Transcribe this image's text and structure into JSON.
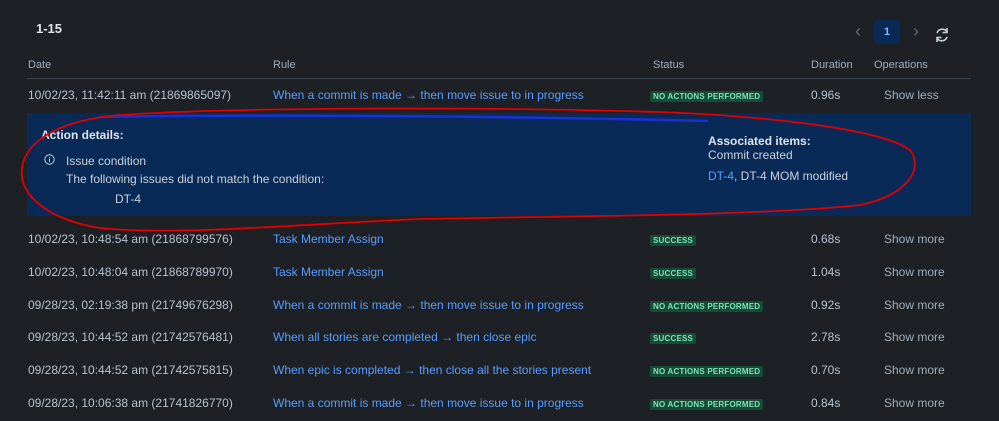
{
  "range": "1-15",
  "pager": {
    "prev": "‹",
    "page": "1",
    "next": "›"
  },
  "headers": {
    "date": "Date",
    "rule": "Rule",
    "status": "Status",
    "duration": "Duration",
    "operations": "Operations"
  },
  "rows": [
    {
      "date": "10/02/23, 11:42:11 am (21869865097)",
      "rule": "When a commit is made → then move issue to in progress",
      "status": "NO ACTIONS PERFORMED",
      "duration": "0.96s",
      "op": "Show less"
    },
    {
      "date": "10/02/23, 10:48:54 am (21868799576)",
      "rule": "Task Member Assign",
      "status": "SUCCESS",
      "duration": "0.68s",
      "op": "Show more"
    },
    {
      "date": "10/02/23, 10:48:04 am (21868789970)",
      "rule": "Task Member Assign",
      "status": "SUCCESS",
      "duration": "1.04s",
      "op": "Show more"
    },
    {
      "date": "09/28/23, 02:19:38 pm (21749676298)",
      "rule": "When a commit is made → then move issue to in progress",
      "status": "NO ACTIONS PERFORMED",
      "duration": "0.92s",
      "op": "Show more"
    },
    {
      "date": "09/28/23, 10:44:52 am (21742576481)",
      "rule": "When all stories are completed → then close epic",
      "status": "SUCCESS",
      "duration": "2.78s",
      "op": "Show more"
    },
    {
      "date": "09/28/23, 10:44:52 am (21742575815)",
      "rule": "When epic is completed → then close all the stories present",
      "status": "NO ACTIONS PERFORMED",
      "duration": "0.70s",
      "op": "Show more"
    },
    {
      "date": "09/28/23, 10:06:38 am (21741826770)",
      "rule": "When a commit is made → then move issue to in progress",
      "status": "NO ACTIONS PERFORMED",
      "duration": "0.84s",
      "op": "Show more"
    }
  ],
  "details": {
    "title": "Action details:",
    "condition": "Issue condition",
    "message": "The following issues did not match the condition:",
    "issue_key": "DT-4",
    "assoc_title": "Associated items:",
    "assoc_sub": "Commit created",
    "assoc_link": "DT-4",
    "assoc_rest": ", DT-4 MOM modified"
  },
  "colors": {
    "annotation": "#e00000",
    "annotation_underline": "#1a2fd6"
  }
}
